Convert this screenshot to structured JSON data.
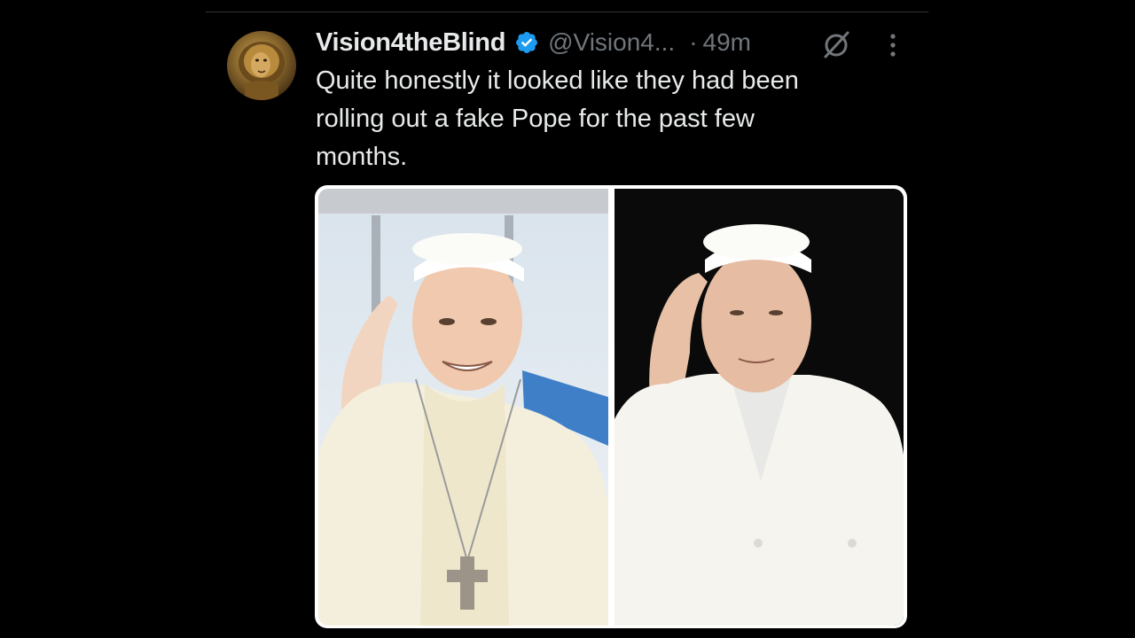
{
  "tweet": {
    "display_name": "Vision4theBlind",
    "verified_icon": "verified-badge-icon",
    "handle": "@Vision4...",
    "separator": "·",
    "time": "49m",
    "text": "Quite honestly it looked like they had been\nrolling out a fake Pope for the past few\nmonths.",
    "media_count": 2
  },
  "colors": {
    "background": "#000000",
    "primary_text": "#e7e9ea",
    "secondary_text": "#71767b",
    "verified_blue": "#1d9bf0",
    "divider": "#2f3336"
  },
  "icons": {
    "grok": "grok-icon",
    "more": "more-icon"
  }
}
